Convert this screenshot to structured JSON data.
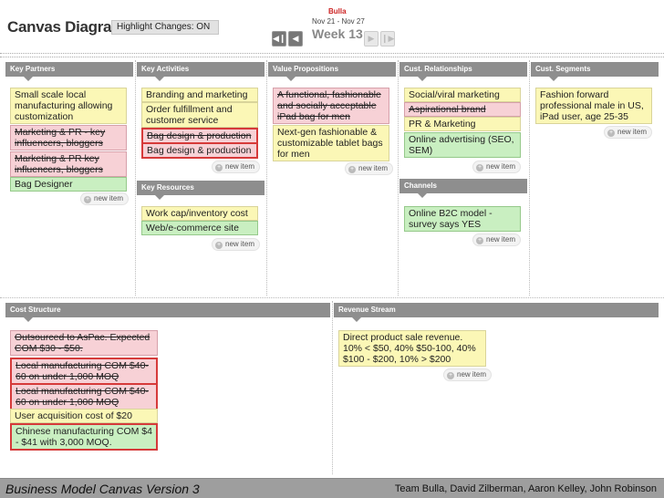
{
  "header": {
    "title": "Canvas Diagram",
    "highlight_toggle": "Highlight Changes: ON",
    "team_name": "Bulla",
    "date_range": "Nov 21 - Nov 27",
    "week": "Week 13"
  },
  "nav": {
    "first": "◀❙",
    "prev": "◀",
    "next": "▶",
    "last": "❙▶"
  },
  "new_item_label": "new item",
  "sections": {
    "key_partners": {
      "title": "Key Partners",
      "items": [
        "Small scale local manufacturing allowing customization",
        "Marketing & PR - key influencers, bloggers",
        "Marketing & PR key influencers, bloggers",
        "Bag Designer"
      ]
    },
    "key_activities": {
      "title": "Key Activities",
      "items": [
        "Branding and marketing",
        "Order fulfillment and customer service",
        "Bag design & production",
        "Bag design & production"
      ]
    },
    "key_resources": {
      "title": "Key Resources",
      "items": [
        "Work cap/inventory cost",
        "Web/e-commerce site"
      ]
    },
    "value_propositions": {
      "title": "Value Propositions",
      "items": [
        "A functional, fashionable and socially acceptable iPad bag for men",
        "Next-gen fashionable & customizable tablet bags for men"
      ]
    },
    "cust_relationships": {
      "title": "Cust. Relationships",
      "items": [
        "Social/viral marketing",
        "Aspirational brand",
        "PR & Marketing",
        "Online advertising (SEO, SEM)"
      ]
    },
    "channels": {
      "title": "Channels",
      "items": [
        "Online B2C model - survey says YES"
      ]
    },
    "cust_segments": {
      "title": "Cust. Segments",
      "items": [
        "Fashion forward professional male in US, iPad user, age 25-35"
      ]
    },
    "cost_structure": {
      "title": "Cost Structure",
      "items": [
        "Outsourced to AsPac. Expected COM $30 - $50.",
        "Local manufacturing COM $40-60 on under 1,000 MOQ",
        "Local manufacturing COM $40-60 on under 1,000 MOQ",
        "User acquisition cost of $20",
        "Chinese manufacturing COM $4 - $41 with 3,000 MOQ."
      ]
    },
    "revenue_stream": {
      "title": "Revenue Stream",
      "items": [
        "Direct product sale revenue. 10% < $50, 40% $50-100, 40% $100 - $200, 10% > $200"
      ]
    }
  },
  "footer": {
    "left": "Business Model Canvas Version 3",
    "right": "Team Bulla,  David Zilberman, Aaron Kelley, John Robinson"
  },
  "colors": {
    "yellow_note": "#fbf7b6",
    "red_note": "#f7d1d6",
    "green_note": "#c9efc1",
    "outline": "#d63a3a",
    "section_header": "#8e8e8e",
    "footer": "#9e9e9e"
  }
}
